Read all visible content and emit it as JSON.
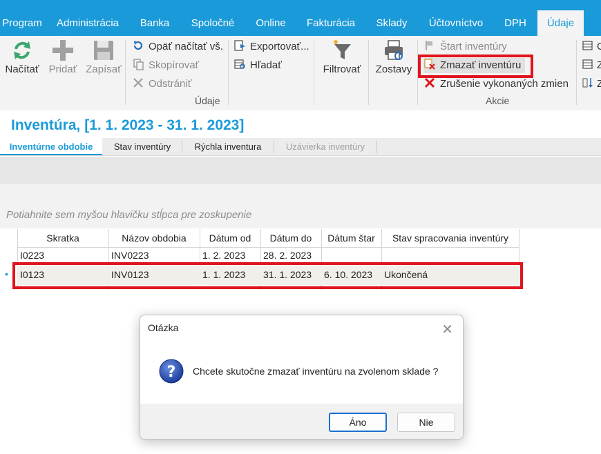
{
  "menu": {
    "items": [
      "Program",
      "Administrácia",
      "Banka",
      "Spoločné",
      "Online",
      "Fakturácia",
      "Sklady",
      "Účtovníctvo",
      "DPH",
      "Údaje"
    ],
    "active": "Údaje"
  },
  "ribbon": {
    "nacitat": "Načítať",
    "pridat": "Pridať",
    "zapisat": "Zapísať",
    "opat_nacitat": "Opäť načítať vš.",
    "skopirovat": "Skopírovať",
    "odstranit": "Odstrániť",
    "udaje_group": "Údaje",
    "exportovat": "Exportovať...",
    "hladat": "Hľadať",
    "filtrovat": "Filtrovať",
    "zostavy": "Zostavy",
    "start_inventury": "Štart inventúry",
    "zmazat_inventuru": "Zmazať inventúru",
    "zrusenie": "Zrušenie vykonaných zmien",
    "akcie_group": "Akcie",
    "partial_1": "O",
    "partial_2": "Z",
    "partial_3": "Z"
  },
  "page": {
    "title": "Inventúra,  [1. 1. 2023 - 31. 1. 2023]"
  },
  "tabs": [
    "Inventúrne obdobie",
    "Stav inventúry",
    "Rýchla inventura",
    "Uzávierka inventúry"
  ],
  "grid": {
    "group_hint": "Potiahnite sem myšou hlavičku stĺpca pre zoskupenie",
    "columns": [
      "Skratka",
      "Názov obdobia",
      "Dátum od",
      "Dátum do",
      "Dátum štar",
      "Stav spracovania inventúry"
    ],
    "rows": [
      [
        "I0223",
        "INV0223",
        "1. 2. 2023",
        "28. 2. 2023",
        "",
        ""
      ],
      [
        "I0123",
        "INV0123",
        "1. 1. 2023",
        "31. 1. 2023",
        "6. 10. 2023",
        "Ukončená"
      ]
    ],
    "row_marker": "•"
  },
  "dialog": {
    "title": "Otázka",
    "message": "Chcete skutočne zmazať inventúru na zvolenom sklade ?",
    "yes": "Áno",
    "no": "Nie",
    "close": "✕"
  },
  "colors": {
    "accent": "#1a9ad8",
    "highlight": "#e0141e"
  }
}
